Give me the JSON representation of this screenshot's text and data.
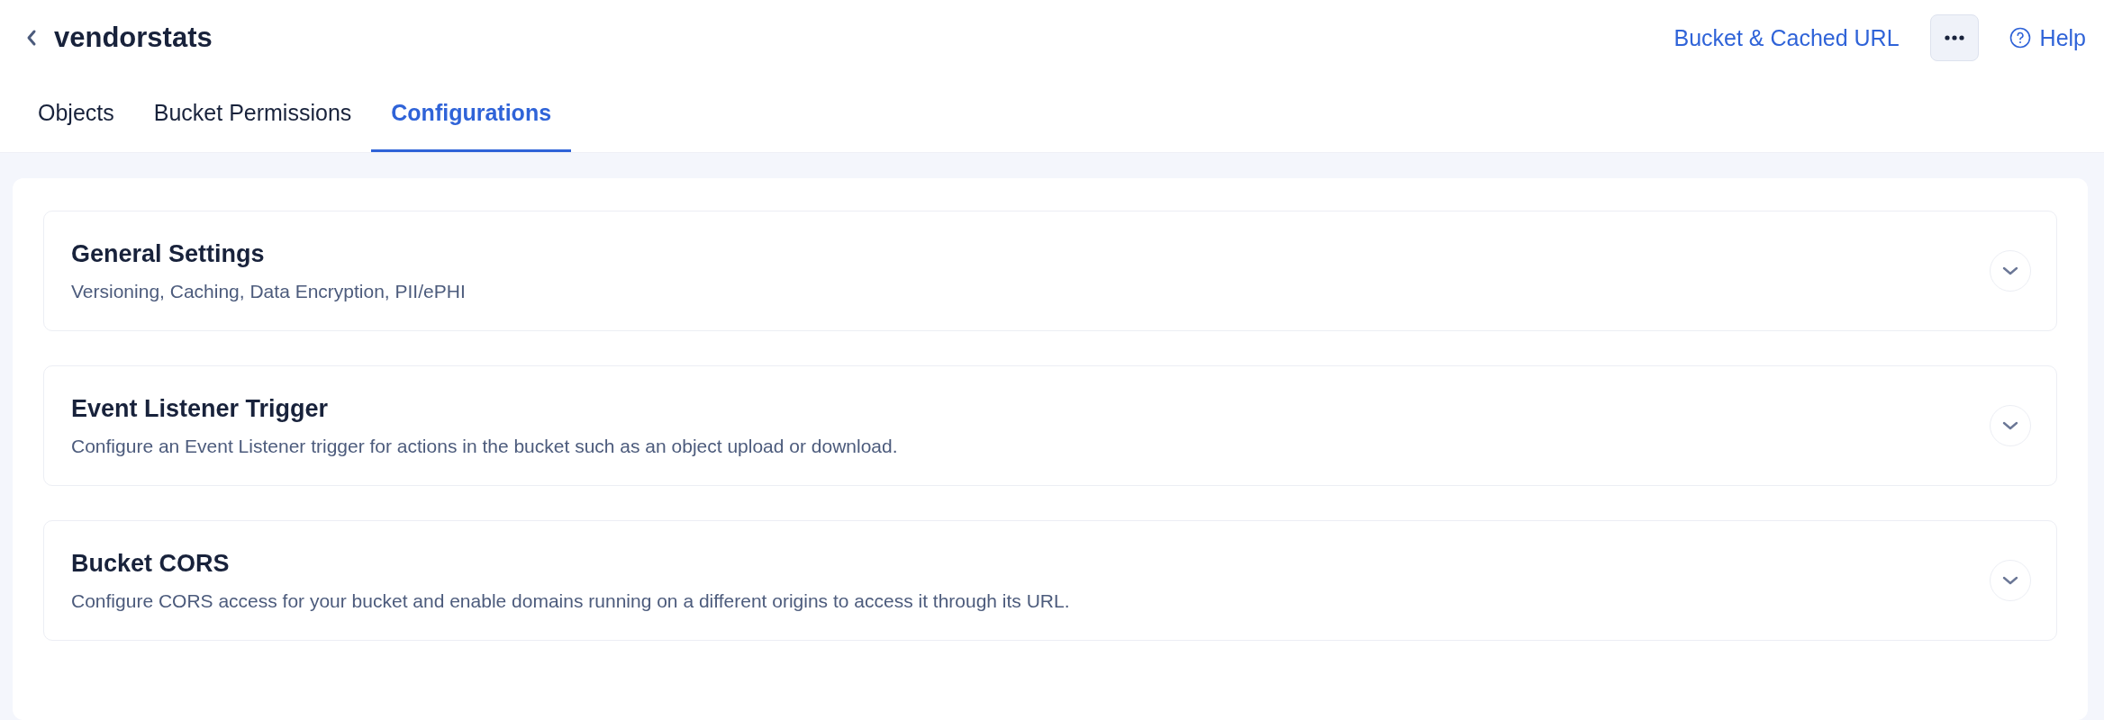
{
  "header": {
    "title": "vendorstats",
    "link": "Bucket & Cached URL",
    "help": "Help"
  },
  "tabs": [
    {
      "label": "Objects",
      "selected": false
    },
    {
      "label": "Bucket Permissions",
      "selected": false
    },
    {
      "label": "Configurations",
      "selected": true
    }
  ],
  "sections": [
    {
      "title": "General Settings",
      "description": "Versioning, Caching, Data Encryption, PII/ePHI",
      "expanded": false
    },
    {
      "title": "Event Listener Trigger",
      "description": "Configure an Event Listener trigger for actions in the bucket such as an object upload or download.",
      "expanded": false
    },
    {
      "title": "Bucket CORS",
      "description": "Configure CORS access for your bucket and enable domains running on a different origins to access it through its URL.",
      "expanded": false
    }
  ]
}
